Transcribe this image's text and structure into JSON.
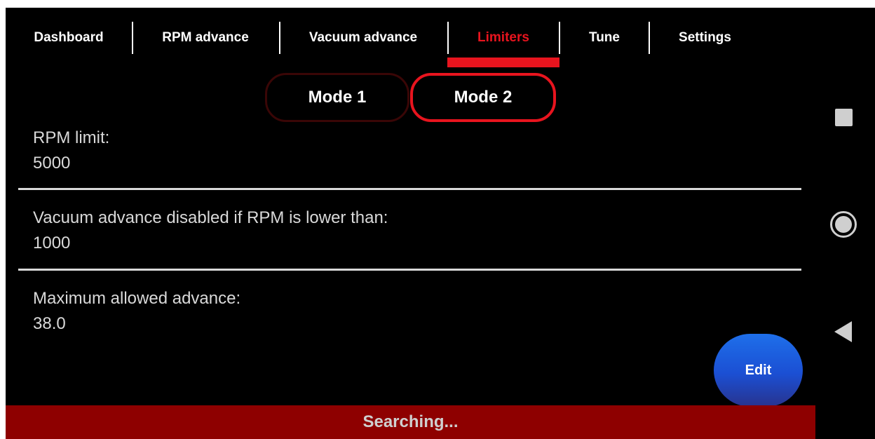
{
  "tabs": [
    {
      "label": "Dashboard"
    },
    {
      "label": "RPM advance"
    },
    {
      "label": "Vacuum advance"
    },
    {
      "label": "Limiters"
    },
    {
      "label": "Tune"
    },
    {
      "label": "Settings"
    }
  ],
  "active_tab": "Limiters",
  "modes": [
    {
      "label": "Mode 1"
    },
    {
      "label": "Mode 2"
    }
  ],
  "active_mode": "Mode 2",
  "settings": [
    {
      "label": "RPM limit:",
      "value": "5000"
    },
    {
      "label": "Vacuum advance disabled if RPM is lower than:",
      "value": "1000"
    },
    {
      "label": "Maximum allowed advance:",
      "value": "38.0"
    }
  ],
  "edit_label": "Edit",
  "status_text": "Searching...",
  "colors": {
    "accent": "#e8141e",
    "status_bar": "#8e0000",
    "fab": "#1b4fd3",
    "background": "#000000"
  },
  "system_nav": [
    "square-icon",
    "circle-home-icon",
    "back-triangle-icon"
  ]
}
